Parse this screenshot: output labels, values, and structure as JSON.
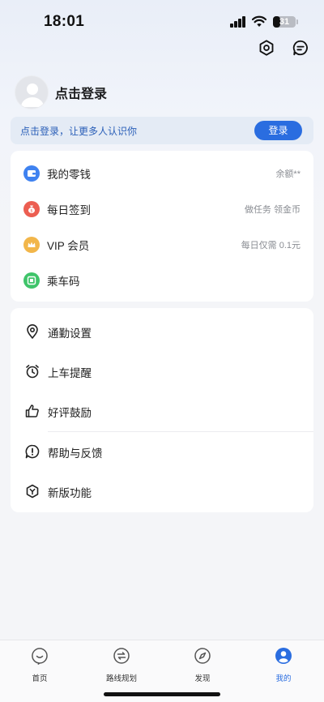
{
  "status_bar": {
    "time": "18:01",
    "battery": "31",
    "battery_level": 0.31
  },
  "header": {
    "settings_icon": "hexagon-settings-icon",
    "message_icon": "chat-bubble-icon"
  },
  "profile": {
    "login_title": "点击登录"
  },
  "login_banner": {
    "text": "点击登录，让更多人认识你",
    "button_label": "登录"
  },
  "wallet_section": {
    "items": [
      {
        "label": "我的零钱",
        "value": "余额**",
        "icon": "wallet-icon",
        "color": "#3f82f0"
      },
      {
        "label": "每日签到",
        "value": "做任务 领金币",
        "icon": "coin-bag-icon",
        "color": "#ec5e51"
      },
      {
        "label": "VIP 会员",
        "value": "每日仅需 0.1元",
        "icon": "crown-icon",
        "color": "#f2b64a"
      },
      {
        "label": "乘车码",
        "value": "",
        "icon": "ride-code-icon",
        "color": "#3fc46a"
      }
    ]
  },
  "settings_section": {
    "items": [
      {
        "label": "通勤设置",
        "icon": "location-pin-icon"
      },
      {
        "label": "上车提醒",
        "icon": "alarm-clock-icon"
      },
      {
        "label": "好评鼓励",
        "icon": "thumbs-up-icon"
      },
      {
        "label": "帮助与反馈",
        "icon": "help-bubble-icon"
      },
      {
        "label": "新版功能",
        "icon": "new-features-icon"
      }
    ]
  },
  "tabbar": {
    "items": [
      {
        "label": "首页",
        "icon": "home-smile-icon",
        "active": false
      },
      {
        "label": "路线规划",
        "icon": "route-icon",
        "active": false
      },
      {
        "label": "发现",
        "icon": "compass-icon",
        "active": false
      },
      {
        "label": "我的",
        "icon": "profile-icon",
        "active": true
      }
    ]
  },
  "colors": {
    "accent": "#2a6de0",
    "banner_bg": "#e4ebf5",
    "banner_text": "#2a5fb8"
  }
}
